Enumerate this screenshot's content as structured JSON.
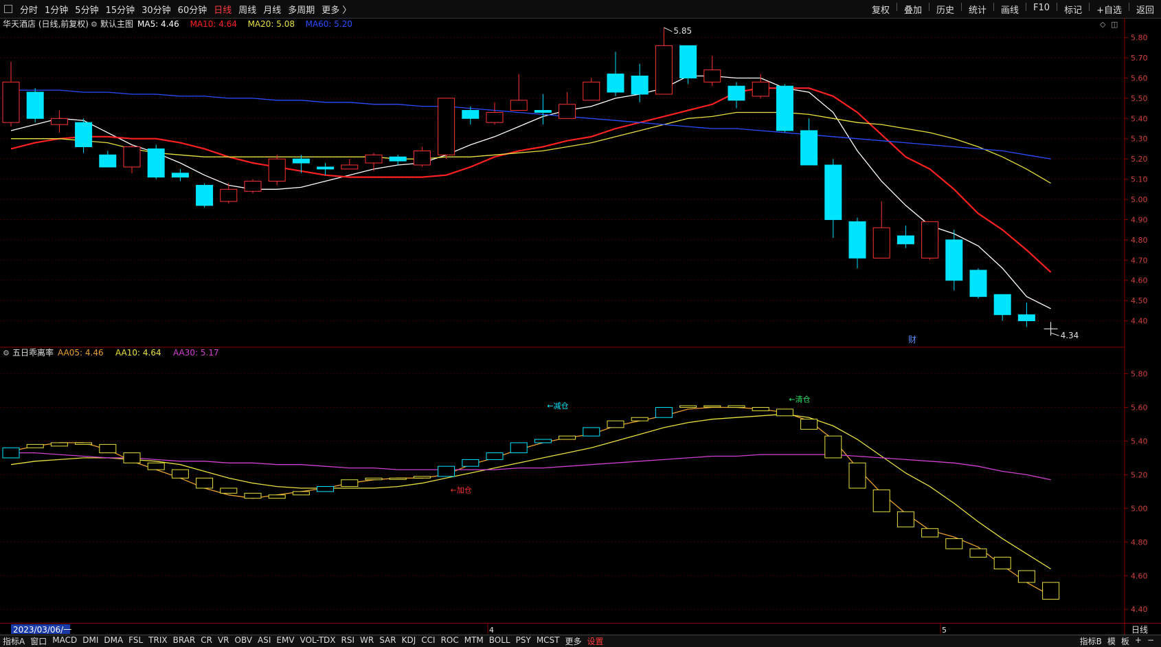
{
  "topbar": {
    "left_icon": "grid-icon",
    "periods": [
      "分时",
      "1分钟",
      "5分钟",
      "15分钟",
      "30分钟",
      "60分钟",
      "日线",
      "周线",
      "月线",
      "多周期",
      "更多 〉"
    ],
    "active_period": "日线",
    "tools": [
      "复权",
      "叠加",
      "历史",
      "统计",
      "画线",
      "F10",
      "标记",
      "+自选",
      "返回"
    ]
  },
  "main_chart": {
    "stock_label": "华天酒店 (日线,前复权)",
    "default_label": "默认主图",
    "ma_legend": [
      {
        "text": "MA5: 4.46",
        "color": "#ffffff"
      },
      {
        "text": "MA10: 4.64",
        "color": "#ff2020"
      },
      {
        "text": "MA20: 5.08",
        "color": "#e8e040"
      },
      {
        "text": "MA60: 5.20",
        "color": "#2a4cff"
      }
    ],
    "high_label": "5.85",
    "low_label": "4.34",
    "fin_marker": "财",
    "yticks": [
      "5.80",
      "5.70",
      "5.60",
      "5.50",
      "5.40",
      "5.30",
      "5.20",
      "5.10",
      "5.00",
      "4.90",
      "4.80",
      "4.70",
      "4.60",
      "4.50",
      "4.40"
    ]
  },
  "sub_chart": {
    "name": "五日乖离率",
    "legend": [
      {
        "text": "AA05: 4.46",
        "color": "#e8a030"
      },
      {
        "text": "AA10: 4.64",
        "color": "#e8e040"
      },
      {
        "text": "AA30: 5.17",
        "color": "#d040d0"
      }
    ],
    "signals": [
      "←加仓",
      "←减仓",
      "←清仓"
    ],
    "yticks": [
      "5.80",
      "5.60",
      "5.40",
      "5.20",
      "5.00",
      "4.80",
      "4.60",
      "4.40"
    ]
  },
  "time_axis": {
    "start_date": "2023/03/06/一",
    "month_labels": [
      "4",
      "5"
    ],
    "right_label": "日线"
  },
  "bottombar": {
    "tab_label": "指标A",
    "window_label": "窗口",
    "indicators": [
      "MACD",
      "DMI",
      "DMA",
      "FSL",
      "TRIX",
      "BRAR",
      "CR",
      "VR",
      "OBV",
      "ASI",
      "EMV",
      "VOL-TDX",
      "RSI",
      "WR",
      "SAR",
      "KDJ",
      "CCI",
      "ROC",
      "MTM",
      "BOLL",
      "PSY",
      "MCST",
      "更多",
      "设置"
    ],
    "right_items": [
      "指标B",
      "模",
      "板",
      "+",
      "−"
    ]
  },
  "chart_data": [
    {
      "type": "candlestick",
      "title": "华天酒店 (日线,前复权)",
      "ylim": [
        4.3,
        5.87
      ],
      "candles": [
        {
          "o": 5.38,
          "c": 5.58,
          "h": 5.68,
          "l": 5.36
        },
        {
          "o": 5.53,
          "c": 5.4,
          "h": 5.55,
          "l": 5.38
        },
        {
          "o": 5.37,
          "c": 5.4,
          "h": 5.44,
          "l": 5.33
        },
        {
          "o": 5.38,
          "c": 5.26,
          "h": 5.4,
          "l": 5.23
        },
        {
          "o": 5.22,
          "c": 5.16,
          "h": 5.24,
          "l": 5.16
        },
        {
          "o": 5.16,
          "c": 5.26,
          "h": 5.27,
          "l": 5.13
        },
        {
          "o": 5.25,
          "c": 5.11,
          "h": 5.27,
          "l": 5.1
        },
        {
          "o": 5.13,
          "c": 5.11,
          "h": 5.15,
          "l": 5.09
        },
        {
          "o": 5.07,
          "c": 4.97,
          "h": 5.08,
          "l": 4.96
        },
        {
          "o": 4.99,
          "c": 5.05,
          "h": 5.08,
          "l": 4.98
        },
        {
          "o": 5.04,
          "c": 5.09,
          "h": 5.1,
          "l": 5.03
        },
        {
          "o": 5.09,
          "c": 5.2,
          "h": 5.22,
          "l": 5.07
        },
        {
          "o": 5.2,
          "c": 5.18,
          "h": 5.22,
          "l": 5.13
        },
        {
          "o": 5.16,
          "c": 5.15,
          "h": 5.18,
          "l": 5.12
        },
        {
          "o": 5.15,
          "c": 5.17,
          "h": 5.2,
          "l": 5.15
        },
        {
          "o": 5.18,
          "c": 5.22,
          "h": 5.23,
          "l": 5.14
        },
        {
          "o": 5.21,
          "c": 5.19,
          "h": 5.22,
          "l": 5.17
        },
        {
          "o": 5.17,
          "c": 5.24,
          "h": 5.26,
          "l": 5.16
        },
        {
          "o": 5.22,
          "c": 5.5,
          "h": 5.5,
          "l": 5.2
        },
        {
          "o": 5.44,
          "c": 5.4,
          "h": 5.46,
          "l": 5.37
        },
        {
          "o": 5.38,
          "c": 5.43,
          "h": 5.48,
          "l": 5.37
        },
        {
          "o": 5.44,
          "c": 5.49,
          "h": 5.62,
          "l": 5.44
        },
        {
          "o": 5.44,
          "c": 5.43,
          "h": 5.52,
          "l": 5.37
        },
        {
          "o": 5.4,
          "c": 5.47,
          "h": 5.53,
          "l": 5.4
        },
        {
          "o": 5.49,
          "c": 5.58,
          "h": 5.6,
          "l": 5.49
        },
        {
          "o": 5.62,
          "c": 5.53,
          "h": 5.73,
          "l": 5.51
        },
        {
          "o": 5.61,
          "c": 5.52,
          "h": 5.67,
          "l": 5.48
        },
        {
          "o": 5.52,
          "c": 5.76,
          "h": 5.85,
          "l": 5.52
        },
        {
          "o": 5.76,
          "c": 5.6,
          "h": 5.76,
          "l": 5.57
        },
        {
          "o": 5.58,
          "c": 5.64,
          "h": 5.71,
          "l": 5.56
        },
        {
          "o": 5.56,
          "c": 5.49,
          "h": 5.58,
          "l": 5.45
        },
        {
          "o": 5.51,
          "c": 5.58,
          "h": 5.62,
          "l": 5.5
        },
        {
          "o": 5.56,
          "c": 5.34,
          "h": 5.57,
          "l": 5.33
        },
        {
          "o": 5.34,
          "c": 5.17,
          "h": 5.4,
          "l": 5.17
        },
        {
          "o": 5.17,
          "c": 4.9,
          "h": 5.2,
          "l": 4.81
        },
        {
          "o": 4.89,
          "c": 4.71,
          "h": 4.91,
          "l": 4.66
        },
        {
          "o": 4.71,
          "c": 4.86,
          "h": 4.99,
          "l": 4.71
        },
        {
          "o": 4.82,
          "c": 4.78,
          "h": 4.87,
          "l": 4.76
        },
        {
          "o": 4.71,
          "c": 4.89,
          "h": 4.89,
          "l": 4.7
        },
        {
          "o": 4.8,
          "c": 4.6,
          "h": 4.85,
          "l": 4.55
        },
        {
          "o": 4.65,
          "c": 4.52,
          "h": 4.66,
          "l": 4.51
        },
        {
          "o": 4.53,
          "c": 4.43,
          "h": 4.53,
          "l": 4.4
        },
        {
          "o": 4.43,
          "c": 4.4,
          "h": 4.49,
          "l": 4.37
        }
      ],
      "series": [
        {
          "name": "MA5",
          "color": "#ffffff",
          "values": [
            5.34,
            5.37,
            5.4,
            5.39,
            5.33,
            5.27,
            5.23,
            5.18,
            5.12,
            5.07,
            5.05,
            5.05,
            5.06,
            5.09,
            5.12,
            5.15,
            5.17,
            5.18,
            5.22,
            5.27,
            5.31,
            5.36,
            5.41,
            5.44,
            5.46,
            5.5,
            5.52,
            5.55,
            5.61,
            5.61,
            5.6,
            5.6,
            5.55,
            5.53,
            5.43,
            5.24,
            5.09,
            4.97,
            4.87,
            4.83,
            4.77,
            4.66,
            4.52,
            4.46
          ]
        },
        {
          "name": "MA10",
          "color": "#ff2020",
          "values": [
            5.25,
            5.28,
            5.3,
            5.31,
            5.31,
            5.3,
            5.3,
            5.28,
            5.25,
            5.21,
            5.18,
            5.16,
            5.14,
            5.12,
            5.11,
            5.11,
            5.11,
            5.11,
            5.12,
            5.16,
            5.21,
            5.24,
            5.26,
            5.29,
            5.31,
            5.35,
            5.38,
            5.41,
            5.44,
            5.47,
            5.53,
            5.55,
            5.55,
            5.55,
            5.51,
            5.43,
            5.32,
            5.21,
            5.15,
            5.05,
            4.93,
            4.85,
            4.75,
            4.64
          ]
        },
        {
          "name": "MA20",
          "color": "#e8e040",
          "values": [
            5.3,
            5.3,
            5.3,
            5.29,
            5.28,
            5.25,
            5.23,
            5.22,
            5.21,
            5.21,
            5.21,
            5.21,
            5.21,
            5.21,
            5.21,
            5.21,
            5.2,
            5.2,
            5.21,
            5.21,
            5.22,
            5.23,
            5.24,
            5.26,
            5.28,
            5.31,
            5.34,
            5.37,
            5.4,
            5.41,
            5.43,
            5.43,
            5.43,
            5.42,
            5.4,
            5.38,
            5.37,
            5.35,
            5.33,
            5.3,
            5.26,
            5.21,
            5.15,
            5.08
          ]
        },
        {
          "name": "MA60",
          "color": "#2a4cff",
          "values": [
            5.54,
            5.54,
            5.54,
            5.53,
            5.53,
            5.52,
            5.52,
            5.51,
            5.51,
            5.5,
            5.5,
            5.49,
            5.49,
            5.48,
            5.48,
            5.47,
            5.47,
            5.46,
            5.46,
            5.45,
            5.44,
            5.43,
            5.42,
            5.41,
            5.4,
            5.39,
            5.38,
            5.37,
            5.36,
            5.35,
            5.35,
            5.34,
            5.33,
            5.32,
            5.31,
            5.3,
            5.29,
            5.28,
            5.27,
            5.26,
            5.25,
            5.24,
            5.22,
            5.2
          ]
        }
      ],
      "annotations": [
        {
          "text": "5.85",
          "index": 27,
          "value": 5.85
        },
        {
          "text": "4.34",
          "index": 43,
          "value": 4.34
        }
      ]
    },
    {
      "type": "line",
      "title": "五日乖离率",
      "ylim": [
        4.36,
        5.88
      ],
      "boxes": [
        {
          "o": 5.3,
          "c": 5.36,
          "color": "#00e5ff"
        },
        {
          "o": 5.36,
          "c": 5.38,
          "color": "#e8e040"
        },
        {
          "o": 5.37,
          "c": 5.39,
          "color": "#e8e040"
        },
        {
          "o": 5.39,
          "c": 5.38,
          "color": "#e8e040"
        },
        {
          "o": 5.38,
          "c": 5.33,
          "color": "#e8e040"
        },
        {
          "o": 5.33,
          "c": 5.27,
          "color": "#e8e040"
        },
        {
          "o": 5.27,
          "c": 5.23,
          "color": "#e8e040"
        },
        {
          "o": 5.23,
          "c": 5.18,
          "color": "#e8e040"
        },
        {
          "o": 5.18,
          "c": 5.12,
          "color": "#e8e040"
        },
        {
          "o": 5.12,
          "c": 5.09,
          "color": "#e8e040"
        },
        {
          "o": 5.09,
          "c": 5.06,
          "color": "#e8e040"
        },
        {
          "o": 5.06,
          "c": 5.08,
          "color": "#e8e040"
        },
        {
          "o": 5.08,
          "c": 5.1,
          "color": "#e8e040"
        },
        {
          "o": 5.1,
          "c": 5.13,
          "color": "#00e5ff"
        },
        {
          "o": 5.13,
          "c": 5.17,
          "color": "#e8e040"
        },
        {
          "o": 5.17,
          "c": 5.18,
          "color": "#e8e040"
        },
        {
          "o": 5.18,
          "c": 5.18,
          "color": "#e8e040"
        },
        {
          "o": 5.18,
          "c": 5.19,
          "color": "#e8e040"
        },
        {
          "o": 5.19,
          "c": 5.25,
          "color": "#00e5ff"
        },
        {
          "o": 5.25,
          "c": 5.29,
          "color": "#00e5ff"
        },
        {
          "o": 5.29,
          "c": 5.33,
          "color": "#00e5ff"
        },
        {
          "o": 5.33,
          "c": 5.39,
          "color": "#00e5ff"
        },
        {
          "o": 5.39,
          "c": 5.41,
          "color": "#00e5ff"
        },
        {
          "o": 5.41,
          "c": 5.43,
          "color": "#e8e040"
        },
        {
          "o": 5.43,
          "c": 5.48,
          "color": "#00e5ff"
        },
        {
          "o": 5.48,
          "c": 5.52,
          "color": "#e8e040"
        },
        {
          "o": 5.52,
          "c": 5.54,
          "color": "#e8e040"
        },
        {
          "o": 5.54,
          "c": 5.6,
          "color": "#00e5ff"
        },
        {
          "o": 5.6,
          "c": 5.61,
          "color": "#e8e040"
        },
        {
          "o": 5.61,
          "c": 5.61,
          "color": "#e8e040"
        },
        {
          "o": 5.61,
          "c": 5.6,
          "color": "#e8e040"
        },
        {
          "o": 5.6,
          "c": 5.58,
          "color": "#e8e040"
        },
        {
          "o": 5.59,
          "c": 5.55,
          "color": "#e8e040"
        },
        {
          "o": 5.53,
          "c": 5.47,
          "color": "#e8e040"
        },
        {
          "o": 5.43,
          "c": 5.3,
          "color": "#e8e040"
        },
        {
          "o": 5.27,
          "c": 5.12,
          "color": "#e8e040"
        },
        {
          "o": 5.11,
          "c": 4.98,
          "color": "#e8e040"
        },
        {
          "o": 4.98,
          "c": 4.89,
          "color": "#e8e040"
        },
        {
          "o": 4.88,
          "c": 4.83,
          "color": "#e8e040"
        },
        {
          "o": 4.82,
          "c": 4.76,
          "color": "#e8e040"
        },
        {
          "o": 4.76,
          "c": 4.71,
          "color": "#e8e040"
        },
        {
          "o": 4.71,
          "c": 4.64,
          "color": "#e8e040"
        },
        {
          "o": 4.63,
          "c": 4.56,
          "color": "#e8e040"
        },
        {
          "o": 4.56,
          "c": 4.46,
          "color": "#e8e040"
        }
      ],
      "series": [
        {
          "name": "AA05",
          "color": "#e8a030",
          "values": [
            5.34,
            5.37,
            5.39,
            5.39,
            5.35,
            5.28,
            5.23,
            5.18,
            5.12,
            5.08,
            5.06,
            5.08,
            5.1,
            5.12,
            5.15,
            5.17,
            5.18,
            5.18,
            5.2,
            5.26,
            5.3,
            5.35,
            5.39,
            5.42,
            5.44,
            5.49,
            5.52,
            5.55,
            5.59,
            5.6,
            5.6,
            5.59,
            5.57,
            5.52,
            5.41,
            5.24,
            5.09,
            4.97,
            4.87,
            4.83,
            4.77,
            4.66,
            4.56,
            4.48
          ]
        },
        {
          "name": "AA10",
          "color": "#e8e040",
          "values": [
            5.26,
            5.28,
            5.29,
            5.3,
            5.3,
            5.29,
            5.28,
            5.26,
            5.22,
            5.18,
            5.15,
            5.13,
            5.12,
            5.12,
            5.12,
            5.12,
            5.13,
            5.15,
            5.18,
            5.21,
            5.24,
            5.27,
            5.3,
            5.33,
            5.36,
            5.4,
            5.44,
            5.48,
            5.51,
            5.53,
            5.54,
            5.55,
            5.56,
            5.54,
            5.49,
            5.41,
            5.31,
            5.21,
            5.13,
            5.03,
            4.92,
            4.82,
            4.73,
            4.64
          ]
        },
        {
          "name": "AA30",
          "color": "#d040d0",
          "values": [
            5.33,
            5.33,
            5.32,
            5.31,
            5.3,
            5.3,
            5.29,
            5.28,
            5.28,
            5.27,
            5.27,
            5.26,
            5.26,
            5.25,
            5.24,
            5.24,
            5.23,
            5.23,
            5.23,
            5.23,
            5.23,
            5.24,
            5.24,
            5.25,
            5.26,
            5.27,
            5.28,
            5.29,
            5.3,
            5.31,
            5.31,
            5.32,
            5.32,
            5.32,
            5.32,
            5.31,
            5.3,
            5.29,
            5.28,
            5.27,
            5.25,
            5.22,
            5.2,
            5.17
          ]
        }
      ],
      "signal_points": [
        {
          "text": "←加仓",
          "index": 18,
          "value": 5.11
        },
        {
          "text": "←减仓",
          "index": 22,
          "value": 5.61
        },
        {
          "text": "←清仓",
          "index": 32,
          "value": 5.65
        }
      ]
    }
  ]
}
